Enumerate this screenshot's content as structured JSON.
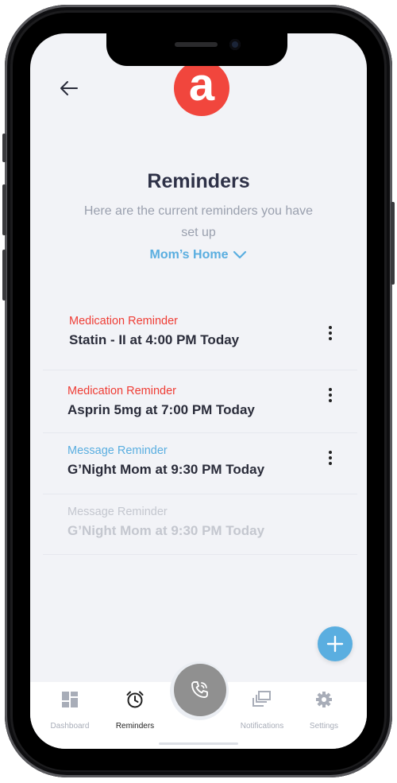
{
  "header": {
    "logo_letter": "a",
    "title": "Reminders",
    "subtitle": "Here are the current reminders you have set up",
    "location": "Mom’s Home"
  },
  "reminders": [
    {
      "type": "Medication Reminder",
      "text": "Statin - II at 4:00 PM Today",
      "category": "medication",
      "enabled": true
    },
    {
      "type": "Medication Reminder",
      "text": "Asprin 5mg at 7:00 PM Today",
      "category": "medication",
      "enabled": true
    },
    {
      "type": "Message Reminder",
      "text": "G’Night Mom at 9:30 PM Today",
      "category": "message",
      "enabled": true
    },
    {
      "type": "Message Reminder",
      "text": "G’Night Mom at 9:30 PM Today",
      "category": "message",
      "enabled": false
    }
  ],
  "tabs": [
    {
      "label": "Dashboard",
      "icon": "dashboard-icon",
      "active": false
    },
    {
      "label": "Reminders",
      "icon": "alarm-clock-icon",
      "active": true
    },
    {
      "label": "Notifications",
      "icon": "notifications-icon",
      "active": false
    },
    {
      "label": "Settings",
      "icon": "gear-icon",
      "active": false
    }
  ],
  "colors": {
    "brand_red": "#f1463d",
    "accent_blue": "#5aaee0",
    "medication": "#ef3d35",
    "disabled": "#c4c7cf",
    "call_button": "#909090"
  }
}
